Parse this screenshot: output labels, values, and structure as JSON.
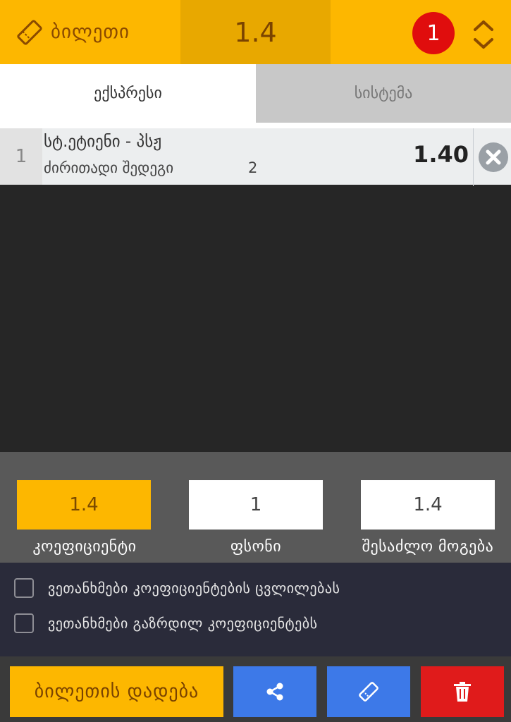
{
  "header": {
    "title": "ბილეთი",
    "total_odds": "1.4",
    "badge_count": "1",
    "brand_color": "#fdb700"
  },
  "tabs": [
    {
      "label": "ექსპრესი",
      "active": true
    },
    {
      "label": "სისტემა",
      "active": false
    }
  ],
  "bet": {
    "index": "1",
    "event": "სტ.ეტიენი - პსჟ",
    "market": "ძირითადი შედეგი",
    "outcome": "2",
    "odd": "1.40"
  },
  "panel": {
    "coefficient_value": "1.4",
    "coefficient_label": "კოეფიციენტი",
    "stake_value": "1",
    "stake_label": "ფსონი",
    "win_value": "1.4",
    "win_label": "შესაძლო მოგება"
  },
  "options": [
    {
      "label": "ვეთანხმები კოეფიციენტების ცვლილებას",
      "checked": false
    },
    {
      "label": "ვეთანხმები გაზრდილ კოეფიციენტებს",
      "checked": false
    }
  ],
  "actions": {
    "place_label": "ბილეთის დადება",
    "share_icon": "share-icon",
    "ticket_icon": "ticket-icon",
    "trash_icon": "trash-icon"
  }
}
